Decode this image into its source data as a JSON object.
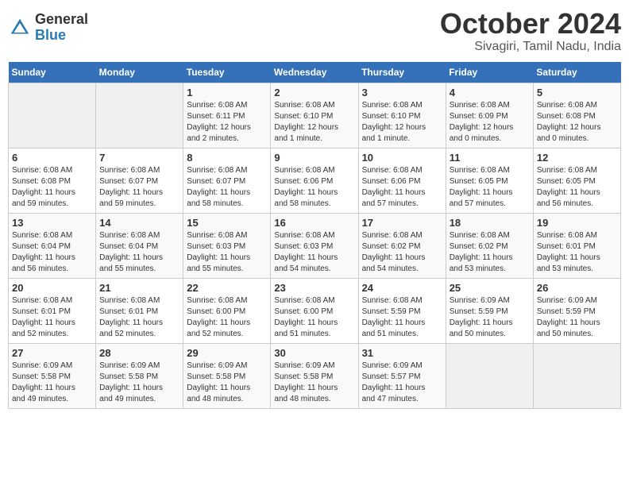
{
  "logo": {
    "general": "General",
    "blue": "Blue"
  },
  "title": "October 2024",
  "location": "Sivagiri, Tamil Nadu, India",
  "days_header": [
    "Sunday",
    "Monday",
    "Tuesday",
    "Wednesday",
    "Thursday",
    "Friday",
    "Saturday"
  ],
  "weeks": [
    [
      {
        "day": "",
        "info": ""
      },
      {
        "day": "",
        "info": ""
      },
      {
        "day": "1",
        "info": "Sunrise: 6:08 AM\nSunset: 6:11 PM\nDaylight: 12 hours\nand 2 minutes."
      },
      {
        "day": "2",
        "info": "Sunrise: 6:08 AM\nSunset: 6:10 PM\nDaylight: 12 hours\nand 1 minute."
      },
      {
        "day": "3",
        "info": "Sunrise: 6:08 AM\nSunset: 6:10 PM\nDaylight: 12 hours\nand 1 minute."
      },
      {
        "day": "4",
        "info": "Sunrise: 6:08 AM\nSunset: 6:09 PM\nDaylight: 12 hours\nand 0 minutes."
      },
      {
        "day": "5",
        "info": "Sunrise: 6:08 AM\nSunset: 6:08 PM\nDaylight: 12 hours\nand 0 minutes."
      }
    ],
    [
      {
        "day": "6",
        "info": "Sunrise: 6:08 AM\nSunset: 6:08 PM\nDaylight: 11 hours\nand 59 minutes."
      },
      {
        "day": "7",
        "info": "Sunrise: 6:08 AM\nSunset: 6:07 PM\nDaylight: 11 hours\nand 59 minutes."
      },
      {
        "day": "8",
        "info": "Sunrise: 6:08 AM\nSunset: 6:07 PM\nDaylight: 11 hours\nand 58 minutes."
      },
      {
        "day": "9",
        "info": "Sunrise: 6:08 AM\nSunset: 6:06 PM\nDaylight: 11 hours\nand 58 minutes."
      },
      {
        "day": "10",
        "info": "Sunrise: 6:08 AM\nSunset: 6:06 PM\nDaylight: 11 hours\nand 57 minutes."
      },
      {
        "day": "11",
        "info": "Sunrise: 6:08 AM\nSunset: 6:05 PM\nDaylight: 11 hours\nand 57 minutes."
      },
      {
        "day": "12",
        "info": "Sunrise: 6:08 AM\nSunset: 6:05 PM\nDaylight: 11 hours\nand 56 minutes."
      }
    ],
    [
      {
        "day": "13",
        "info": "Sunrise: 6:08 AM\nSunset: 6:04 PM\nDaylight: 11 hours\nand 56 minutes."
      },
      {
        "day": "14",
        "info": "Sunrise: 6:08 AM\nSunset: 6:04 PM\nDaylight: 11 hours\nand 55 minutes."
      },
      {
        "day": "15",
        "info": "Sunrise: 6:08 AM\nSunset: 6:03 PM\nDaylight: 11 hours\nand 55 minutes."
      },
      {
        "day": "16",
        "info": "Sunrise: 6:08 AM\nSunset: 6:03 PM\nDaylight: 11 hours\nand 54 minutes."
      },
      {
        "day": "17",
        "info": "Sunrise: 6:08 AM\nSunset: 6:02 PM\nDaylight: 11 hours\nand 54 minutes."
      },
      {
        "day": "18",
        "info": "Sunrise: 6:08 AM\nSunset: 6:02 PM\nDaylight: 11 hours\nand 53 minutes."
      },
      {
        "day": "19",
        "info": "Sunrise: 6:08 AM\nSunset: 6:01 PM\nDaylight: 11 hours\nand 53 minutes."
      }
    ],
    [
      {
        "day": "20",
        "info": "Sunrise: 6:08 AM\nSunset: 6:01 PM\nDaylight: 11 hours\nand 52 minutes."
      },
      {
        "day": "21",
        "info": "Sunrise: 6:08 AM\nSunset: 6:01 PM\nDaylight: 11 hours\nand 52 minutes."
      },
      {
        "day": "22",
        "info": "Sunrise: 6:08 AM\nSunset: 6:00 PM\nDaylight: 11 hours\nand 52 minutes."
      },
      {
        "day": "23",
        "info": "Sunrise: 6:08 AM\nSunset: 6:00 PM\nDaylight: 11 hours\nand 51 minutes."
      },
      {
        "day": "24",
        "info": "Sunrise: 6:08 AM\nSunset: 5:59 PM\nDaylight: 11 hours\nand 51 minutes."
      },
      {
        "day": "25",
        "info": "Sunrise: 6:09 AM\nSunset: 5:59 PM\nDaylight: 11 hours\nand 50 minutes."
      },
      {
        "day": "26",
        "info": "Sunrise: 6:09 AM\nSunset: 5:59 PM\nDaylight: 11 hours\nand 50 minutes."
      }
    ],
    [
      {
        "day": "27",
        "info": "Sunrise: 6:09 AM\nSunset: 5:58 PM\nDaylight: 11 hours\nand 49 minutes."
      },
      {
        "day": "28",
        "info": "Sunrise: 6:09 AM\nSunset: 5:58 PM\nDaylight: 11 hours\nand 49 minutes."
      },
      {
        "day": "29",
        "info": "Sunrise: 6:09 AM\nSunset: 5:58 PM\nDaylight: 11 hours\nand 48 minutes."
      },
      {
        "day": "30",
        "info": "Sunrise: 6:09 AM\nSunset: 5:58 PM\nDaylight: 11 hours\nand 48 minutes."
      },
      {
        "day": "31",
        "info": "Sunrise: 6:09 AM\nSunset: 5:57 PM\nDaylight: 11 hours\nand 47 minutes."
      },
      {
        "day": "",
        "info": ""
      },
      {
        "day": "",
        "info": ""
      }
    ]
  ]
}
